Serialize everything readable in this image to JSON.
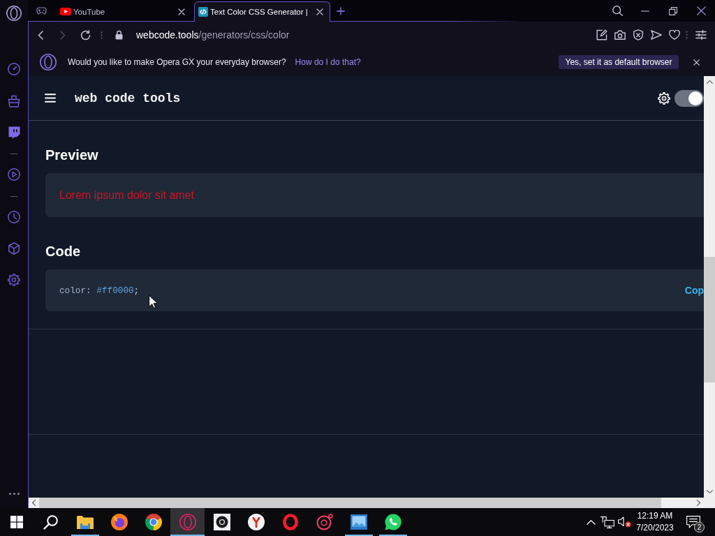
{
  "tabs": [
    {
      "title": "YouTube",
      "selected": false
    },
    {
      "title": "Text Color CSS Generator |",
      "selected": true
    }
  ],
  "address_bar": {
    "domain": "webcode.tools",
    "path": "/generators/css/color"
  },
  "infobar": {
    "message": "Would you like to make Opera GX your everyday browser?",
    "link": "How do I do that?",
    "button": "Yes, set it as default browser"
  },
  "site_header": {
    "title": "web code tools",
    "theme_toggle": {
      "on": true
    }
  },
  "sections": [
    {
      "kind": "preview",
      "heading": "Preview",
      "text": "Lorem ipsum dolor sit amet"
    },
    {
      "kind": "code",
      "heading": "Code",
      "tokens": [
        {
          "kind": "property",
          "text": "color:"
        },
        {
          "kind": "value",
          "text": "#ff0000"
        },
        {
          "kind": "punctuation",
          "text": ";"
        }
      ],
      "action": "Cop"
    }
  ],
  "taskbar": {
    "apps": [
      {
        "kind": "folder",
        "running": true,
        "selected": false
      },
      {
        "kind": "firefox",
        "running": false,
        "selected": false
      },
      {
        "kind": "chrome",
        "running": false,
        "selected": false
      },
      {
        "kind": "operagx",
        "running": true,
        "selected": true
      },
      {
        "kind": "tile",
        "running": false,
        "selected": false
      },
      {
        "kind": "yandex",
        "running": false,
        "selected": false
      },
      {
        "kind": "opera",
        "running": false,
        "selected": false
      },
      {
        "kind": "orbit",
        "running": false,
        "selected": false
      },
      {
        "kind": "photos",
        "running": true,
        "selected": false
      },
      {
        "kind": "whatsapp",
        "running": true,
        "selected": false
      }
    ],
    "clock": {
      "time": "12:19 AM",
      "date": "7/20/2023"
    },
    "notification_count": "2"
  }
}
